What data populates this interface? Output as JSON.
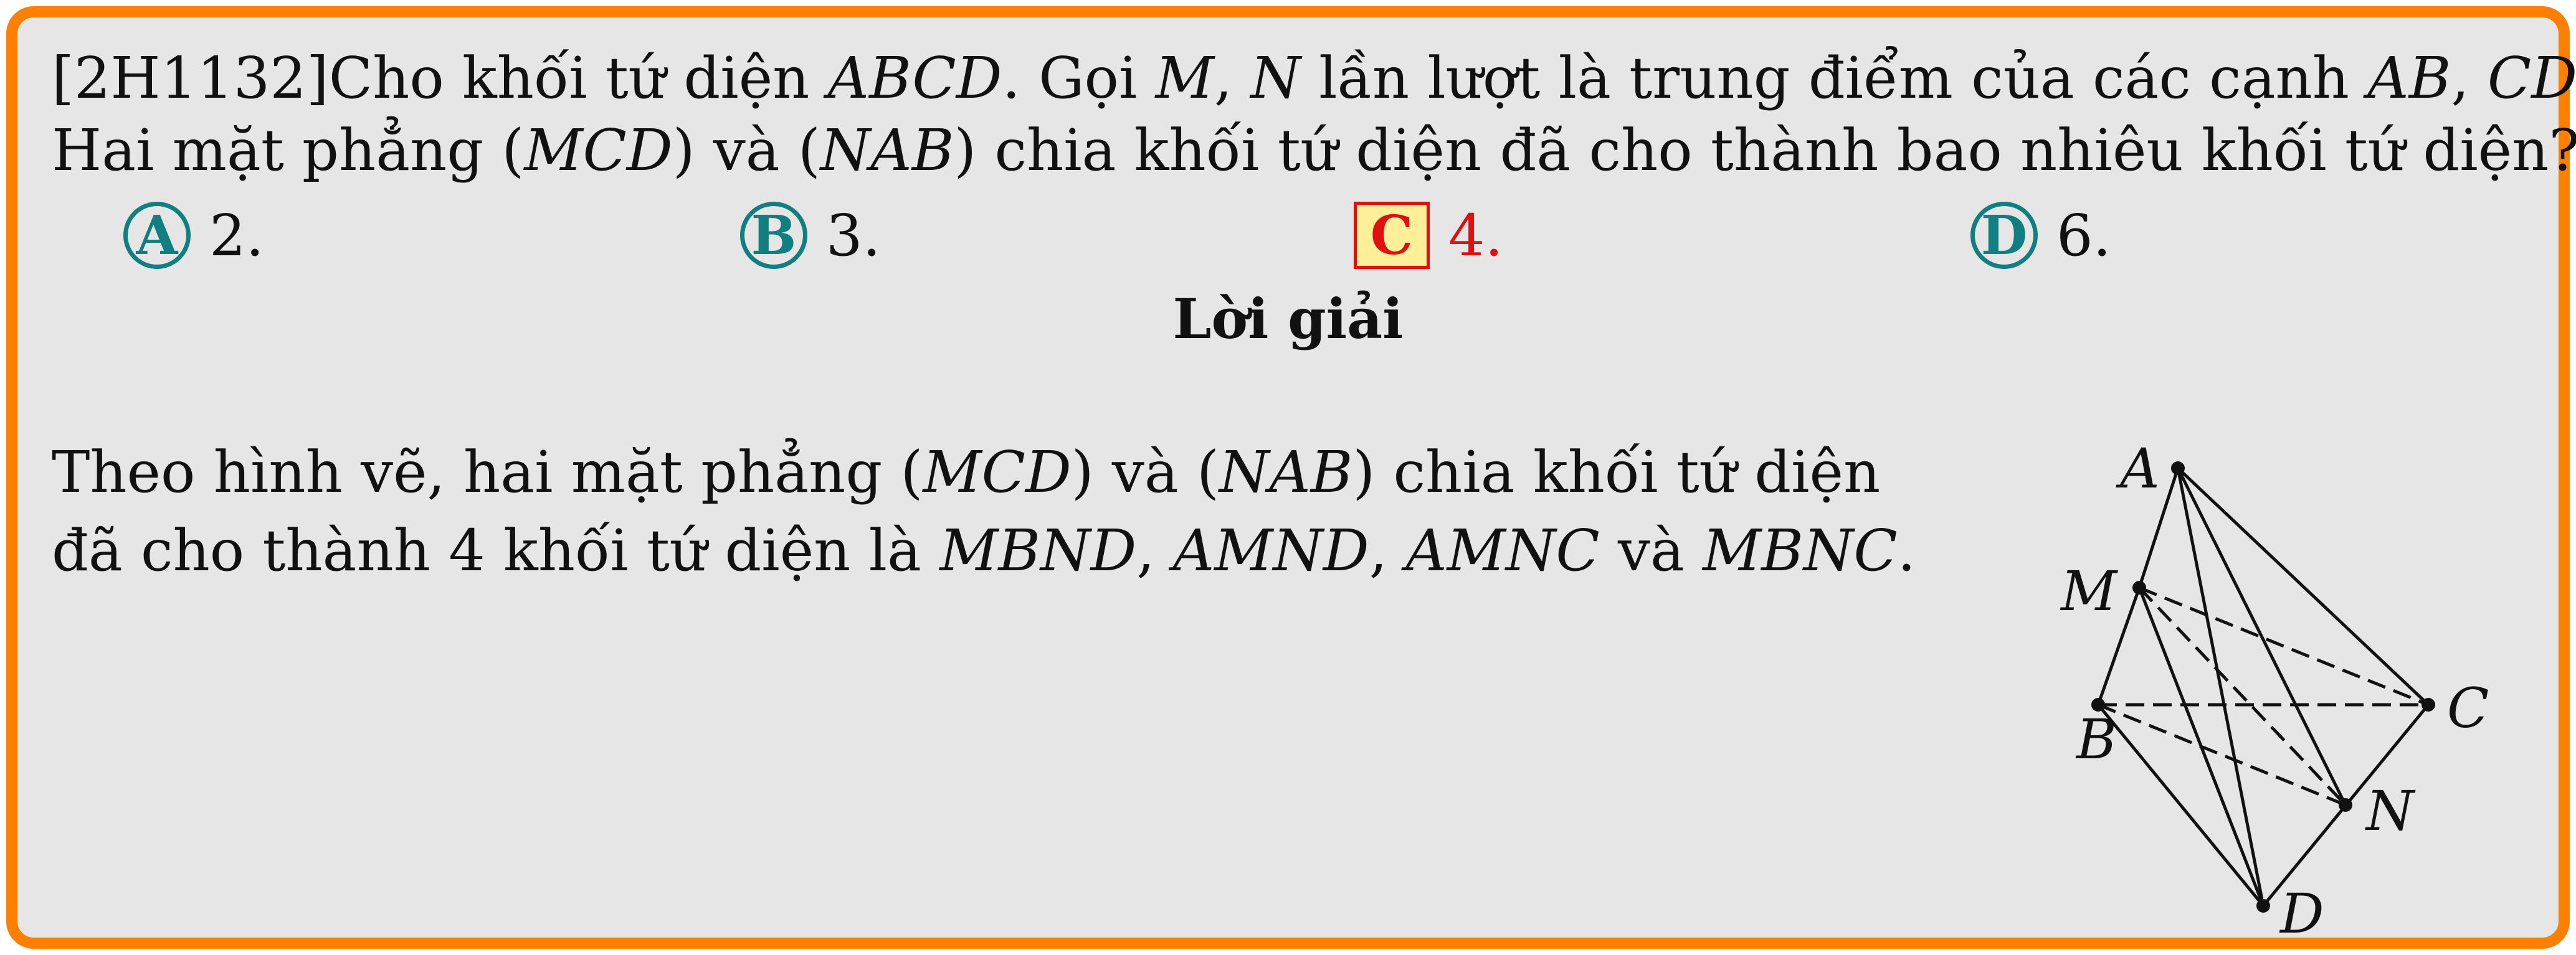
{
  "question": {
    "code": "[2H1132]",
    "line1": [
      {
        "t": "Cho khối tứ diện "
      },
      {
        "m": "ABCD"
      },
      {
        "t": ". Gọi "
      },
      {
        "m": "M"
      },
      {
        "t": ", "
      },
      {
        "m": "N"
      },
      {
        "t": " lần lượt là trung điểm của các cạnh "
      },
      {
        "m": "AB"
      },
      {
        "t": ", "
      },
      {
        "m": "CD"
      },
      {
        "t": "."
      }
    ],
    "line2": [
      {
        "t": "Hai mặt phẳng ("
      },
      {
        "m": "MCD"
      },
      {
        "t": ") và ("
      },
      {
        "m": "NAB"
      },
      {
        "t": ") chia khối tứ diện đã cho thành bao nhiêu khối tứ diện?"
      }
    ]
  },
  "options": [
    {
      "letter": "A",
      "text": "2."
    },
    {
      "letter": "B",
      "text": "3."
    },
    {
      "letter": "C",
      "text": "4.",
      "correct": true
    },
    {
      "letter": "D",
      "text": "6."
    }
  ],
  "solution_title": "Lời giải",
  "explanation": [
    {
      "t": "Theo hình vẽ, hai mặt phẳng ("
    },
    {
      "m": "MCD"
    },
    {
      "t": ") và ("
    },
    {
      "m": "NAB"
    },
    {
      "t": ") chia khối tứ diện đã cho thành 4 khối tứ diện là "
    },
    {
      "m": "MBND"
    },
    {
      "t": ", "
    },
    {
      "m": "AMND"
    },
    {
      "t": ", "
    },
    {
      "m": "AMNC"
    },
    {
      "t": " và "
    },
    {
      "m": "MBNC"
    },
    {
      "t": "."
    }
  ],
  "figure": {
    "points": [
      {
        "name": "A"
      },
      {
        "name": "M"
      },
      {
        "name": "B"
      },
      {
        "name": "C"
      },
      {
        "name": "N"
      },
      {
        "name": "D"
      }
    ]
  },
  "colors": {
    "frame": "#ff8000",
    "background": "#e6e6e6",
    "option_teal": "#0f7f7f",
    "correct_red": "#e01010",
    "correct_fill": "#ffef99"
  }
}
